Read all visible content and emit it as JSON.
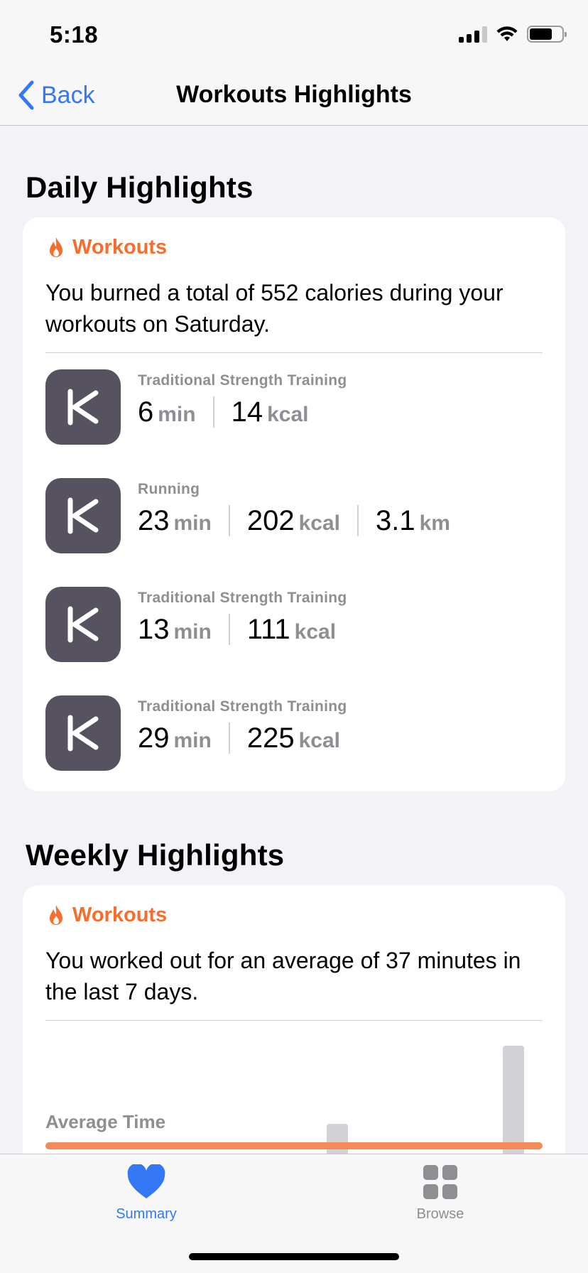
{
  "status_bar": {
    "time": "5:18"
  },
  "nav": {
    "back_label": "Back",
    "title": "Workouts Highlights"
  },
  "daily": {
    "section_title": "Daily Highlights",
    "card_header": "Workouts",
    "summary": "You burned a total of 552 calories during your workouts on Saturday.",
    "workouts": [
      {
        "title": "Traditional Strength Training",
        "metrics": [
          {
            "value": "6",
            "unit": "min"
          },
          {
            "value": "14",
            "unit": "kcal"
          }
        ]
      },
      {
        "title": "Running",
        "metrics": [
          {
            "value": "23",
            "unit": "min"
          },
          {
            "value": "202",
            "unit": "kcal"
          },
          {
            "value": "3.1",
            "unit": "km"
          }
        ]
      },
      {
        "title": "Traditional Strength Training",
        "metrics": [
          {
            "value": "13",
            "unit": "min"
          },
          {
            "value": "111",
            "unit": "kcal"
          }
        ]
      },
      {
        "title": "Traditional Strength Training",
        "metrics": [
          {
            "value": "29",
            "unit": "min"
          },
          {
            "value": "225",
            "unit": "kcal"
          }
        ]
      }
    ]
  },
  "weekly": {
    "section_title": "Weekly Highlights",
    "card_header": "Workouts",
    "summary": "You worked out for an average of 37 minutes in the last 7 days.",
    "average_label": "Average Time"
  },
  "tabs": [
    {
      "label": "Summary",
      "icon": "heart-icon",
      "active": true
    },
    {
      "label": "Browse",
      "icon": "grid-icon",
      "active": false
    }
  ],
  "colors": {
    "accent": "#3478f6",
    "workout_orange": "#f76d2b",
    "avg_line": "#f58a58",
    "app_icon_bg": "#57525f"
  }
}
